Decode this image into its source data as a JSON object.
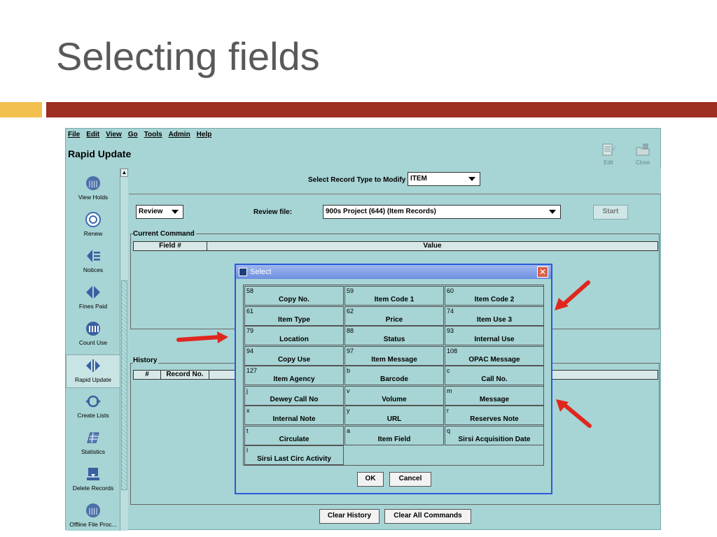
{
  "slide": {
    "title": "Selecting fields"
  },
  "menu": [
    "File",
    "Edit",
    "View",
    "Go",
    "Tools",
    "Admin",
    "Help"
  ],
  "app_title": "Rapid Update",
  "toolbar": {
    "edit_label": "Edit",
    "close_label": "Close"
  },
  "sidebar": [
    {
      "label": "View Holds",
      "icon": "view-holds-icon"
    },
    {
      "label": "Renew",
      "icon": "renew-icon"
    },
    {
      "label": "Notices",
      "icon": "notices-icon"
    },
    {
      "label": "Fines Paid",
      "icon": "fines-paid-icon"
    },
    {
      "label": "Count Use",
      "icon": "count-use-icon"
    },
    {
      "label": "Rapid Update",
      "icon": "rapid-update-icon"
    },
    {
      "label": "Create Lists",
      "icon": "create-lists-icon"
    },
    {
      "label": "Statistics",
      "icon": "statistics-icon"
    },
    {
      "label": "Delete Records",
      "icon": "delete-records-icon"
    },
    {
      "label": "Offline File Proc...",
      "icon": "offline-file-icon"
    }
  ],
  "record_type": {
    "label": "Select Record Type to Modify",
    "value": "ITEM"
  },
  "review": {
    "mode": "Review",
    "file_label": "Review file:",
    "file_value": "900s Project (644) (Item Records)",
    "start_label": "Start"
  },
  "current_command": {
    "title": "Current Command",
    "col_field": "Field #",
    "col_value": "Value"
  },
  "history": {
    "title": "History",
    "col_num": "#",
    "col_record": "Record No."
  },
  "bottom": {
    "clear_history": "Clear History",
    "clear_all": "Clear All Commands"
  },
  "dialog": {
    "title": "Select",
    "ok": "OK",
    "cancel": "Cancel",
    "fields": [
      {
        "code": "58",
        "name": "Copy No."
      },
      {
        "code": "59",
        "name": "Item Code 1"
      },
      {
        "code": "60",
        "name": "Item Code 2"
      },
      {
        "code": "61",
        "name": "Item Type"
      },
      {
        "code": "62",
        "name": "Price"
      },
      {
        "code": "74",
        "name": "Item Use 3"
      },
      {
        "code": "79",
        "name": "Location"
      },
      {
        "code": "88",
        "name": "Status"
      },
      {
        "code": "93",
        "name": "Internal Use"
      },
      {
        "code": "94",
        "name": "Copy Use"
      },
      {
        "code": "97",
        "name": "Item Message"
      },
      {
        "code": "108",
        "name": "OPAC Message"
      },
      {
        "code": "127",
        "name": "Item Agency"
      },
      {
        "code": "b",
        "name": "Barcode"
      },
      {
        "code": "c",
        "name": "Call No."
      },
      {
        "code": "j",
        "name": "Dewey Call No"
      },
      {
        "code": "v",
        "name": "Volume"
      },
      {
        "code": "m",
        "name": "Message"
      },
      {
        "code": "x",
        "name": "Internal Note"
      },
      {
        "code": "y",
        "name": "URL"
      },
      {
        "code": "r",
        "name": "Reserves Note"
      },
      {
        "code": "t",
        "name": "Circulate"
      },
      {
        "code": "a",
        "name": "Item Field"
      },
      {
        "code": "q",
        "name": "Sirsi Acquisition Date"
      },
      {
        "code": "l",
        "name": "Sirsi Last Circ Activity"
      }
    ]
  },
  "colors": {
    "app_bg": "#a7d4d4",
    "title_bar": "#9e2d22",
    "accent_bar": "#f3c04f",
    "arrow": "#e0261e",
    "dialog_border": "#2a5bd7"
  }
}
